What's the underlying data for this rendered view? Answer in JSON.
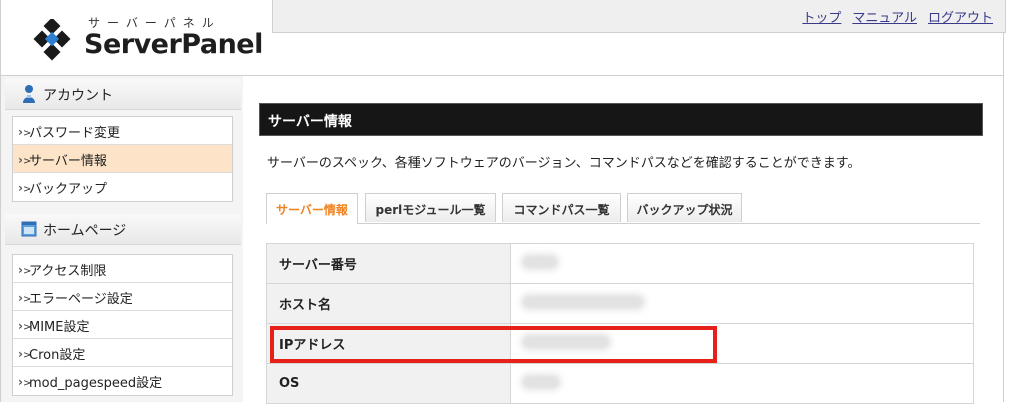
{
  "header": {
    "logo_kana": "サーバーパネル",
    "logo_text": "ServerPanel",
    "links": [
      {
        "label": "トップ"
      },
      {
        "label": "マニュアル"
      },
      {
        "label": "ログアウト"
      }
    ]
  },
  "sidebar": {
    "sections": [
      {
        "heading": "アカウント",
        "icon": "user-icon",
        "items": [
          {
            "label": "パスワード変更",
            "active": false
          },
          {
            "label": "サーバー情報",
            "active": true
          },
          {
            "label": "バックアップ",
            "active": false
          }
        ]
      },
      {
        "heading": "ホームページ",
        "icon": "window-icon",
        "items": [
          {
            "label": "アクセス制限",
            "active": false
          },
          {
            "label": "エラーページ設定",
            "active": false
          },
          {
            "label": "MIME設定",
            "active": false
          },
          {
            "label": "Cron設定",
            "active": false
          },
          {
            "label": "mod_pagespeed設定",
            "active": false
          }
        ]
      }
    ]
  },
  "main": {
    "section_title": "サーバー情報",
    "description": "サーバーのスペック、各種ソフトウェアのバージョン、コマンドパスなどを確認することができます。",
    "tabs": [
      {
        "label": "サーバー情報",
        "active": true
      },
      {
        "label": "perlモジュール一覧",
        "active": false
      },
      {
        "label": "コマンドパス一覧",
        "active": false
      },
      {
        "label": "バックアップ状況",
        "active": false
      }
    ],
    "rows": [
      {
        "key": "サーバー番号",
        "value": ""
      },
      {
        "key": "ホスト名",
        "value": ""
      },
      {
        "key": "IPアドレス",
        "value": ""
      },
      {
        "key": "OS",
        "value": ""
      }
    ]
  },
  "colors": {
    "accent": "#f08320",
    "highlight": "#e8201a",
    "title_bar": "#161616",
    "active_item": "#fde4c8"
  }
}
